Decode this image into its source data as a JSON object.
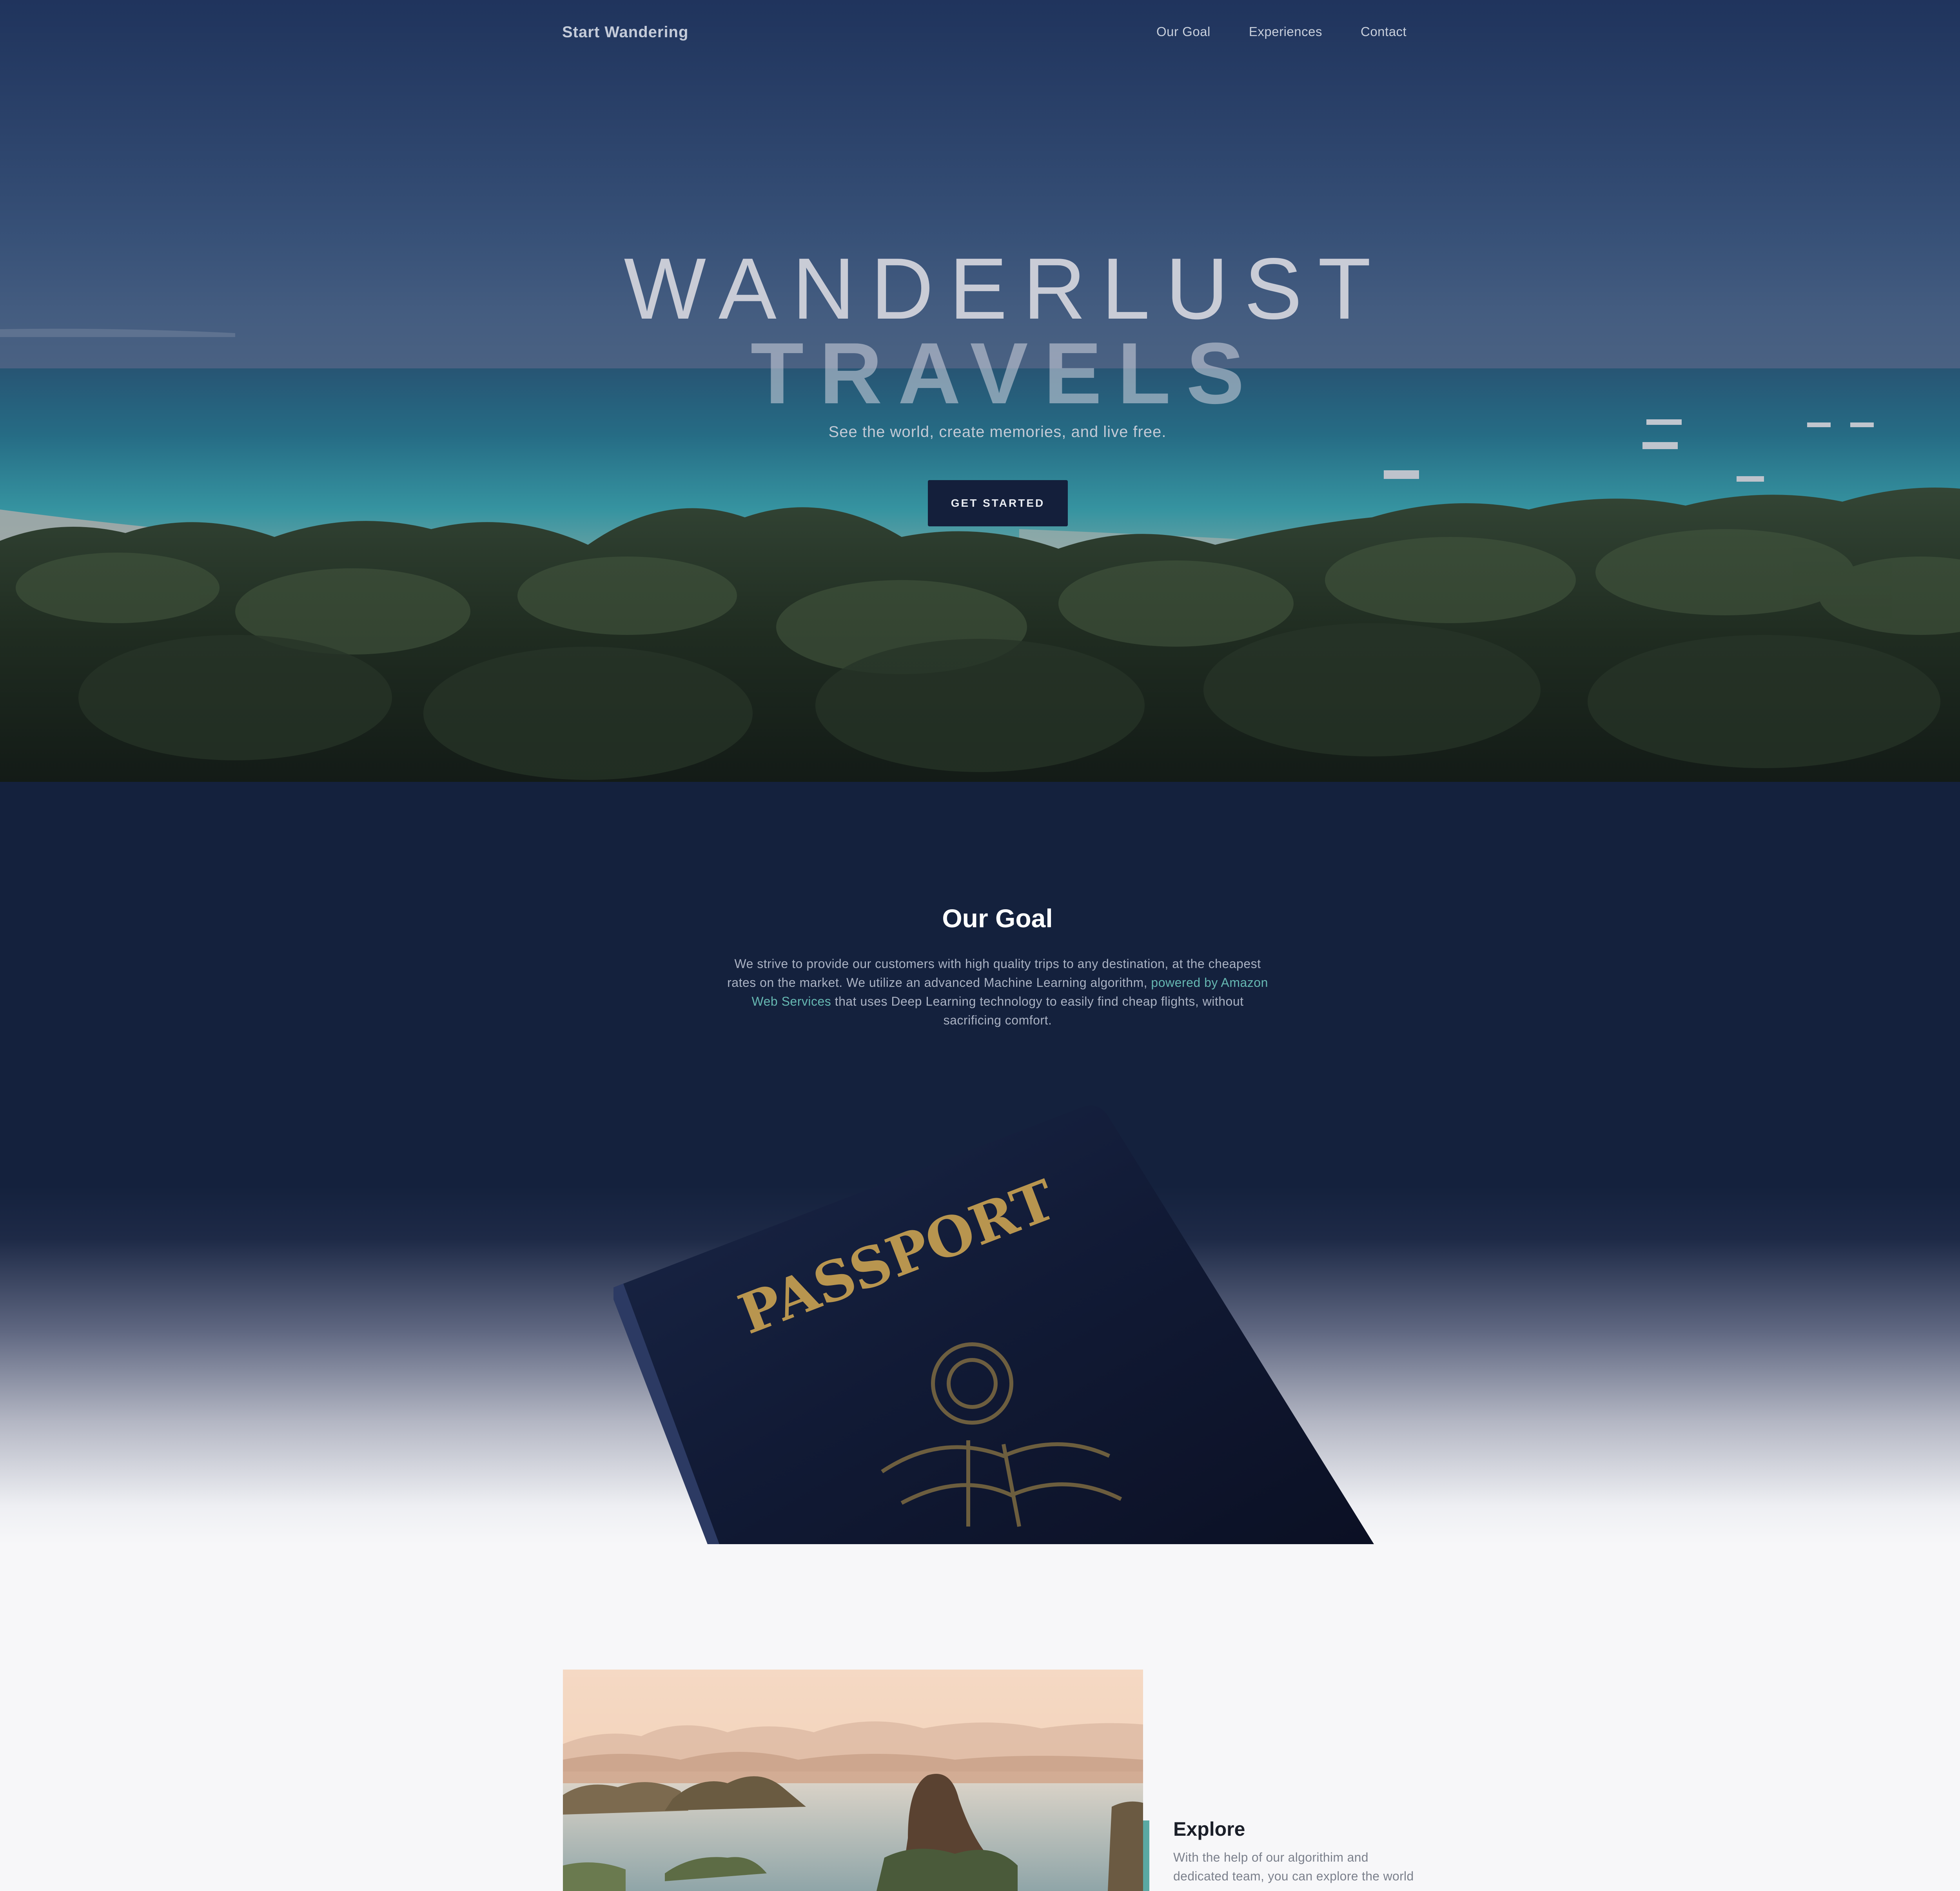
{
  "nav": {
    "brand": "Start Wandering",
    "links": [
      "Our Goal",
      "Experiences",
      "Contact"
    ]
  },
  "hero": {
    "title_line1": "WANDERLUST",
    "title_line2": "TRAVELS",
    "subtitle": "See the world, create memories, and live free.",
    "cta_label": "GET STARTED"
  },
  "goal": {
    "title": "Our Goal",
    "text_before": "We strive to provide our customers with high quality trips to any destination, at the cheapest rates on the market. We utilize an advanced Machine Learning algorithm, ",
    "link_text": "powered by Amazon Web Services",
    "text_after": " that uses Deep Learning technology to easily find cheap flights, without sacrificing comfort.",
    "passport_label": "PASSPORT"
  },
  "feature": {
    "title": "Explore",
    "text": "With the help of our algorithim and dedicated team, you can explore the world"
  },
  "colors": {
    "navy": "#14213d",
    "accent_teal": "#5aa9a3",
    "link_teal": "#66b8b2",
    "page_bg": "#f7f7f9"
  }
}
